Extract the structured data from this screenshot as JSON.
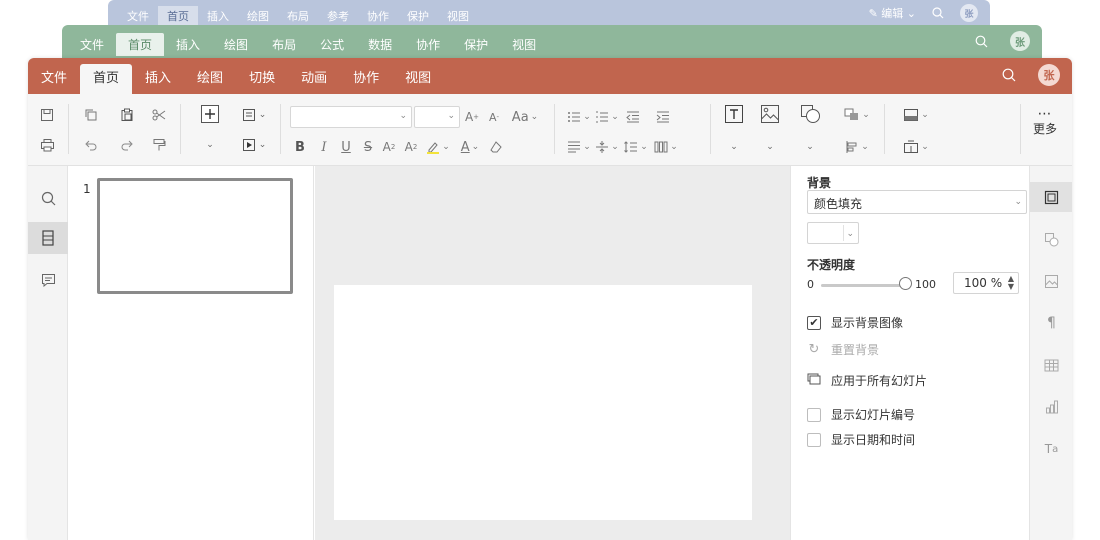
{
  "back_window": {
    "menu": [
      "文件",
      "首页",
      "插入",
      "绘图",
      "布局",
      "参考",
      "协作",
      "保护",
      "视图"
    ],
    "active_index": 1,
    "edit_label": "编辑",
    "avatar": "张"
  },
  "mid_window": {
    "menu": [
      "文件",
      "首页",
      "插入",
      "绘图",
      "布局",
      "公式",
      "数据",
      "协作",
      "保护",
      "视图"
    ],
    "active_index": 1,
    "avatar": "张"
  },
  "front_window": {
    "menu": [
      "文件",
      "首页",
      "插入",
      "绘图",
      "切换",
      "动画",
      "协作",
      "视图"
    ],
    "active_index": 1,
    "avatar": "张",
    "more_label": "更多"
  },
  "thumbnails": [
    {
      "number": "1"
    }
  ],
  "props": {
    "background_title": "背景",
    "fill_select": "颜色填充",
    "opacity_label": "不透明度",
    "opacity_min": "0",
    "opacity_max": "100",
    "opacity_value": "100 %",
    "opacity_level": 100,
    "show_bg_image": "显示背景图像",
    "reset_bg": "重置背景",
    "apply_all": "应用于所有幻灯片",
    "show_slide_number": "显示幻灯片编号",
    "show_date_time": "显示日期和时间"
  },
  "colors": {
    "front_accent": "#c1654e",
    "mid_accent": "#8fb79b",
    "back_accent": "#b9c5dc"
  }
}
